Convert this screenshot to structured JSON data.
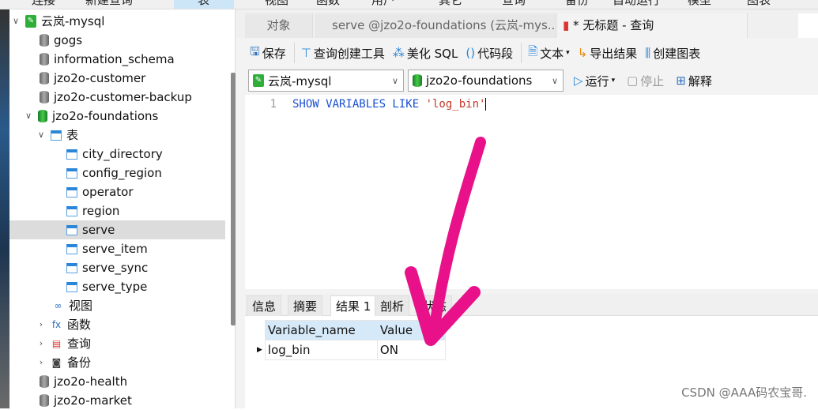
{
  "top_menu": [
    "连接",
    "新建查询",
    "表",
    "视图",
    "函数",
    "用户",
    "其它",
    "查询",
    "备份",
    "自动运行",
    "模型",
    "图表"
  ],
  "sidebar": {
    "connection": "云岚-mysql",
    "items": [
      {
        "label": "gogs",
        "type": "db"
      },
      {
        "label": "information_schema",
        "type": "db"
      },
      {
        "label": "jzo2o-customer",
        "type": "db"
      },
      {
        "label": "jzo2o-customer-backup",
        "type": "db"
      },
      {
        "label": "jzo2o-foundations",
        "type": "db-open"
      }
    ],
    "tables_group": "表",
    "tables": [
      "city_directory",
      "config_region",
      "operator",
      "region",
      "serve",
      "serve_item",
      "serve_sync",
      "serve_type"
    ],
    "selected_table": "serve",
    "groups": [
      "视图",
      "函数",
      "查询",
      "备份"
    ],
    "more_dbs": [
      "jzo2o-health",
      "jzo2o-market"
    ]
  },
  "tabs": {
    "objects": "对象",
    "serve_tab": "serve @jzo2o-foundations (云岚-mys...",
    "query_tab": "* 无标题 - 查询"
  },
  "toolbar": {
    "save": "保存",
    "query_builder": "查询创建工具",
    "beautify": "美化 SQL",
    "snippet": "代码段",
    "text": "文本",
    "export": "导出结果",
    "chart": "创建图表"
  },
  "row2": {
    "connection": "云岚-mysql",
    "database": "jzo2o-foundations",
    "run": "运行",
    "stop": "停止",
    "explain": "解释"
  },
  "editor": {
    "line": "1",
    "keywords": "SHOW VARIABLES LIKE ",
    "string": "'log_bin'"
  },
  "result_tabs": [
    "信息",
    "摘要",
    "结果 1",
    "剖析",
    "状态"
  ],
  "result": {
    "columns": [
      "Variable_name",
      "Value"
    ],
    "rows": [
      [
        "log_bin",
        "ON"
      ]
    ]
  },
  "watermark": "CSDN @AAA码农宝哥.",
  "colors": {
    "annotation_arrow": "#e8118a",
    "header_bg": "#d6e9f8"
  }
}
